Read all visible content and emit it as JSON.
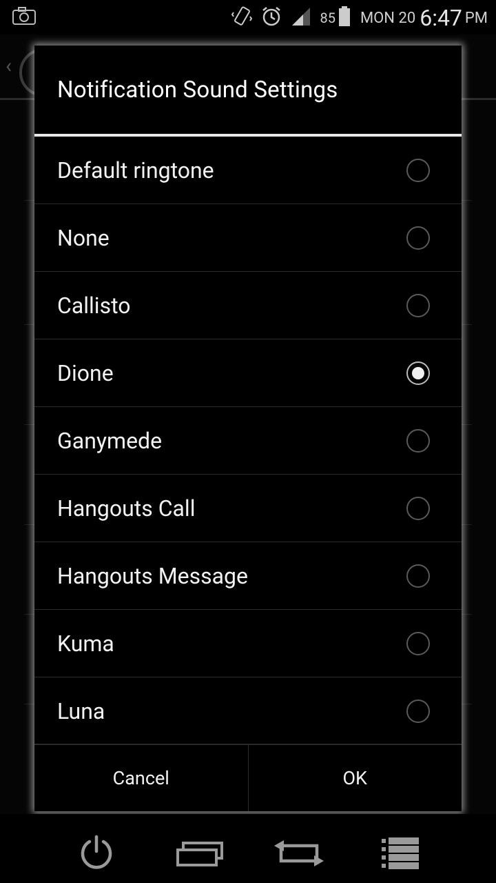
{
  "status_bar": {
    "battery_level": "85",
    "date": "MON 20",
    "time": "6:47",
    "ampm": "PM",
    "icons": [
      "camera-icon",
      "vibrate-icon",
      "alarm-icon",
      "signal-icon",
      "battery-icon"
    ]
  },
  "dialog": {
    "title": "Notification Sound Settings",
    "options": [
      {
        "label": "Default ringtone",
        "checked": false
      },
      {
        "label": "None",
        "checked": false
      },
      {
        "label": "Callisto",
        "checked": false
      },
      {
        "label": "Dione",
        "checked": true
      },
      {
        "label": "Ganymede",
        "checked": false
      },
      {
        "label": "Hangouts Call",
        "checked": false
      },
      {
        "label": "Hangouts Message",
        "checked": false
      },
      {
        "label": "Kuma",
        "checked": false
      },
      {
        "label": "Luna",
        "checked": false
      }
    ],
    "cancel_label": "Cancel",
    "ok_label": "OK"
  },
  "navbar": {
    "icons": [
      "power-icon",
      "recent-apps-icon",
      "switch-icon",
      "menu-list-icon"
    ]
  },
  "colors": {
    "background": "#000000",
    "text": "#f2f2f2",
    "divider": "#2b2b2b",
    "title_rule": "#e8e8e8"
  }
}
